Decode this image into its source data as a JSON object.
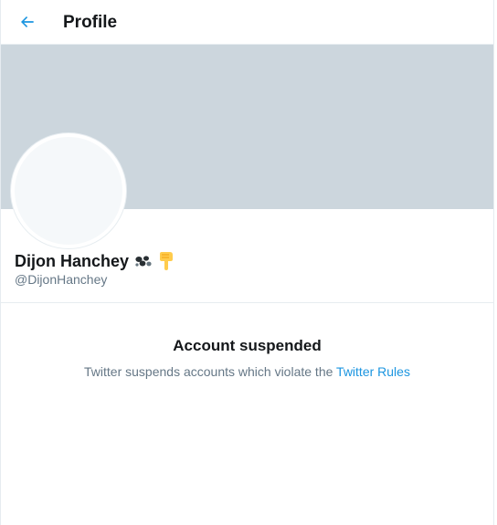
{
  "header": {
    "title": "Profile",
    "back_icon": "arrow-left-icon"
  },
  "profile": {
    "display_name": "Dijon Hanchey",
    "name_emojis": [
      "cow-spots-icon",
      "pointing-down-hand-icon"
    ],
    "handle": "@DijonHanchey"
  },
  "notice": {
    "title": "Account suspended",
    "message": "Twitter suspends accounts which violate the",
    "link_label": "Twitter Rules"
  },
  "colors": {
    "accent": "#1b95e0",
    "banner": "#ccd6dd",
    "secondary_text": "#657786",
    "emoji_yellow": "#ffcc4d"
  }
}
